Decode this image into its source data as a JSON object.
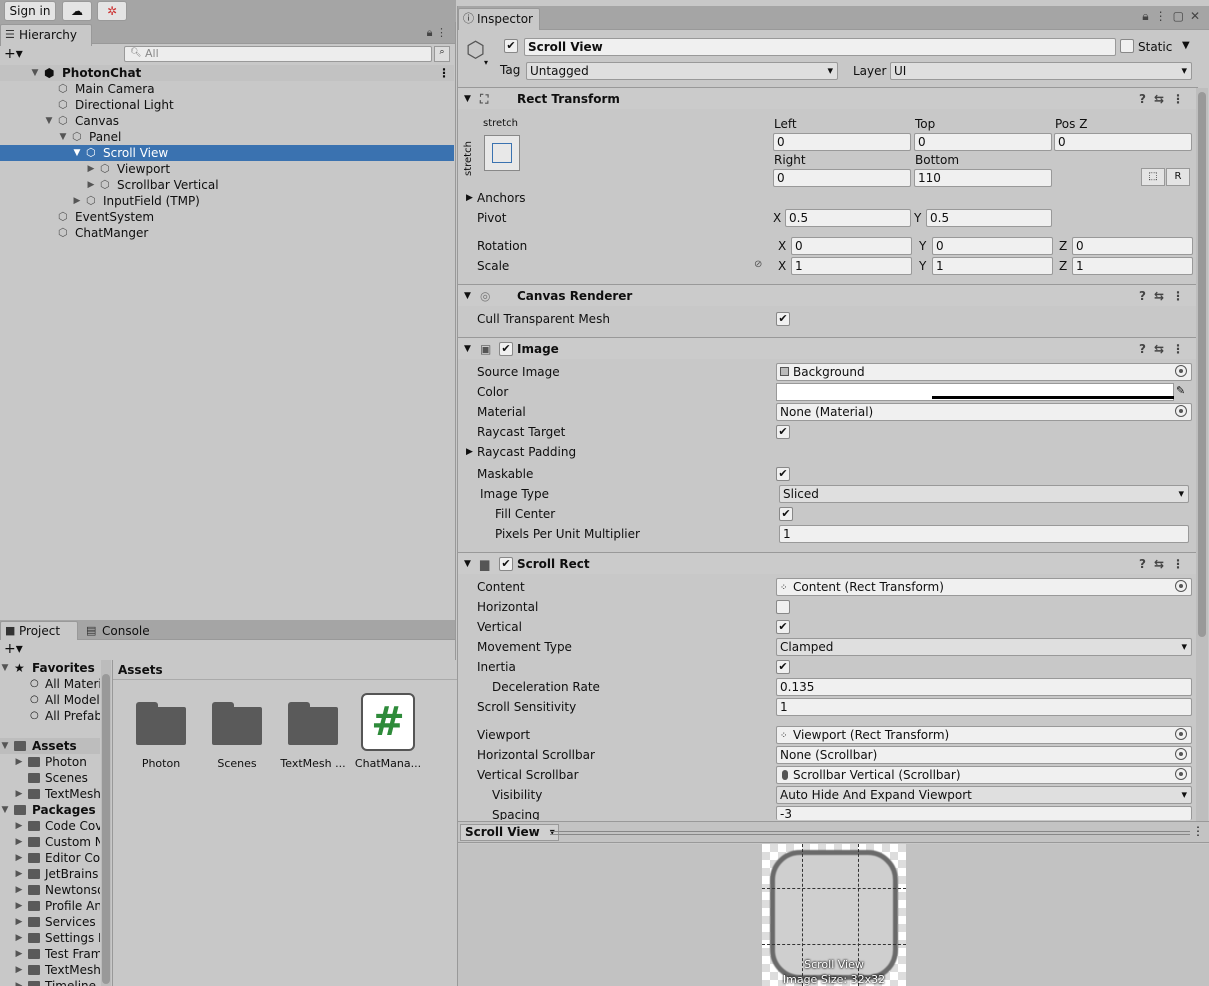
{
  "toolbar": {
    "sign_in": "Sign in"
  },
  "hierarchy": {
    "tab": "Hierarchy",
    "search_placeholder": "All",
    "items": [
      {
        "label": "PhotonChat"
      },
      {
        "label": "Main Camera"
      },
      {
        "label": "Directional Light"
      },
      {
        "label": "Canvas"
      },
      {
        "label": "Panel"
      },
      {
        "label": "Scroll View"
      },
      {
        "label": "Viewport"
      },
      {
        "label": "Scrollbar Vertical"
      },
      {
        "label": "InputField (TMP)"
      },
      {
        "label": "EventSystem"
      },
      {
        "label": "ChatManger"
      }
    ]
  },
  "project": {
    "tab_project": "Project",
    "tab_console": "Console",
    "favorites": {
      "label": "Favorites",
      "items": [
        "All Materi",
        "All Model",
        "All Prefab"
      ]
    },
    "assets_label": "Assets",
    "assets_children": [
      "Photon",
      "Scenes",
      "TextMesh"
    ],
    "packages_label": "Packages",
    "packages_children": [
      "Code Cov",
      "Custom N",
      "Editor Cor",
      "JetBrains",
      "Newtonso",
      "Profile An",
      "Services",
      "Settings M",
      "Test Fram",
      "TextMesh",
      "Timeline"
    ],
    "breadcrumb": "Assets",
    "grid": [
      "Photon",
      "Scenes",
      "TextMesh ...",
      "ChatMana..."
    ],
    "script_glyph": "#"
  },
  "inspector": {
    "tab": "Inspector",
    "object_name": "Scroll View",
    "static_label": "Static",
    "tag_label": "Tag",
    "tag_value": "Untagged",
    "layer_label": "Layer",
    "layer_value": "UI",
    "rect": {
      "title": "Rect Transform",
      "anchor_preset": "stretch",
      "anchor_side": "stretch",
      "left_label": "Left",
      "left": "0",
      "top_label": "Top",
      "top": "0",
      "posz_label": "Pos Z",
      "posz": "0",
      "right_label": "Right",
      "right": "0",
      "bottom_label": "Bottom",
      "bottom": "110",
      "r_button": "R",
      "anchors": "Anchors",
      "pivot": "Pivot",
      "pivot_x": "0.5",
      "pivot_y": "0.5",
      "rotation": "Rotation",
      "rot_x": "0",
      "rot_y": "0",
      "rot_z": "0",
      "scale": "Scale",
      "scale_x": "1",
      "scale_y": "1",
      "scale_z": "1",
      "x": "X",
      "y": "Y",
      "z": "Z"
    },
    "canvas_renderer": {
      "title": "Canvas Renderer",
      "cull": "Cull Transparent Mesh"
    },
    "image": {
      "title": "Image",
      "source_image": "Source Image",
      "source_value": "Background",
      "color": "Color",
      "material": "Material",
      "material_value": "None (Material)",
      "raycast_target": "Raycast Target",
      "raycast_padding": "Raycast Padding",
      "maskable": "Maskable",
      "image_type": "Image Type",
      "image_type_value": "Sliced",
      "fill_center": "Fill Center",
      "ppu": "Pixels Per Unit Multiplier",
      "ppu_value": "1"
    },
    "scroll_rect": {
      "title": "Scroll Rect",
      "content": "Content",
      "content_value": "Content (Rect Transform)",
      "horizontal": "Horizontal",
      "vertical": "Vertical",
      "movement": "Movement Type",
      "movement_value": "Clamped",
      "inertia": "Inertia",
      "decel": "Deceleration Rate",
      "decel_value": "0.135",
      "sensitivity": "Scroll Sensitivity",
      "sensitivity_value": "1",
      "viewport": "Viewport",
      "viewport_value": "Viewport (Rect Transform)",
      "hscroll": "Horizontal Scrollbar",
      "hscroll_value": "None (Scrollbar)",
      "vscroll": "Vertical Scrollbar",
      "vscroll_value": "Scrollbar Vertical (Scrollbar)",
      "visibility": "Visibility",
      "visibility_value": "Auto Hide And Expand Viewport",
      "spacing": "Spacing",
      "spacing_value": "-3"
    },
    "preview": {
      "title": "Scroll View",
      "caption1": "Scroll View",
      "caption2": "Image Size: 32x32"
    }
  }
}
